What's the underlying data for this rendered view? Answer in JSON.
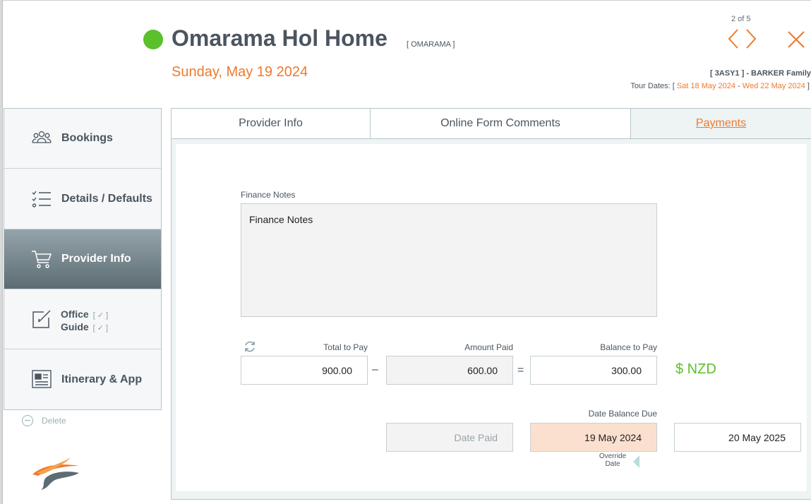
{
  "header": {
    "title": "Omarama Hol Home",
    "code": "[ OMARAMA ]",
    "date": "Sunday, May 19 2024",
    "counter": "2 of 5",
    "booking_ref": "[ 3ASY1 ] - BARKER Family",
    "tour_dates_label": "Tour Dates: [",
    "tour_start": "Sat 18 May 2024",
    "tour_sep": " - ",
    "tour_end": "Wed 22 May 2024",
    "tour_close": " ]",
    "status_color": "#5cc02a",
    "accent_color": "#ee7a2b",
    "prev_icon": "chevron-left-icon",
    "next_icon": "chevron-right-icon",
    "close_icon": "close-icon"
  },
  "sidebar": {
    "items": [
      {
        "label": "Bookings",
        "icon": "people-icon"
      },
      {
        "label": "Details / Defaults",
        "icon": "checklist-icon"
      },
      {
        "label": "Provider Info",
        "icon": "cart-icon",
        "active": true
      },
      {
        "label_1": "Office",
        "label_2": "Guide",
        "check": "[ ✓ ]",
        "icon": "edit-icon"
      },
      {
        "label": "Itinerary & App",
        "icon": "newspaper-icon"
      }
    ],
    "delete_label": "Delete"
  },
  "tabs": [
    {
      "label": "Provider Info"
    },
    {
      "label": "Online Form Comments"
    },
    {
      "label": "Payments",
      "active": true
    }
  ],
  "payments": {
    "finance_notes_label": "Finance Notes",
    "finance_notes_value": "Finance Notes",
    "total_label": "Total to Pay",
    "total_value": "900.00",
    "minus": "–",
    "paid_label": "Amount Paid",
    "paid_value": "600.00",
    "equals": "=",
    "balance_label": "Balance to Pay",
    "balance_value": "300.00",
    "currency": "$ NZD",
    "date_paid_placeholder": "Date Paid",
    "date_due_label": "Date Balance Due",
    "date_due_value": "19 May 2024",
    "override_date_value": "20 May 2025",
    "override_line1": "Override",
    "override_line2": "Date"
  }
}
